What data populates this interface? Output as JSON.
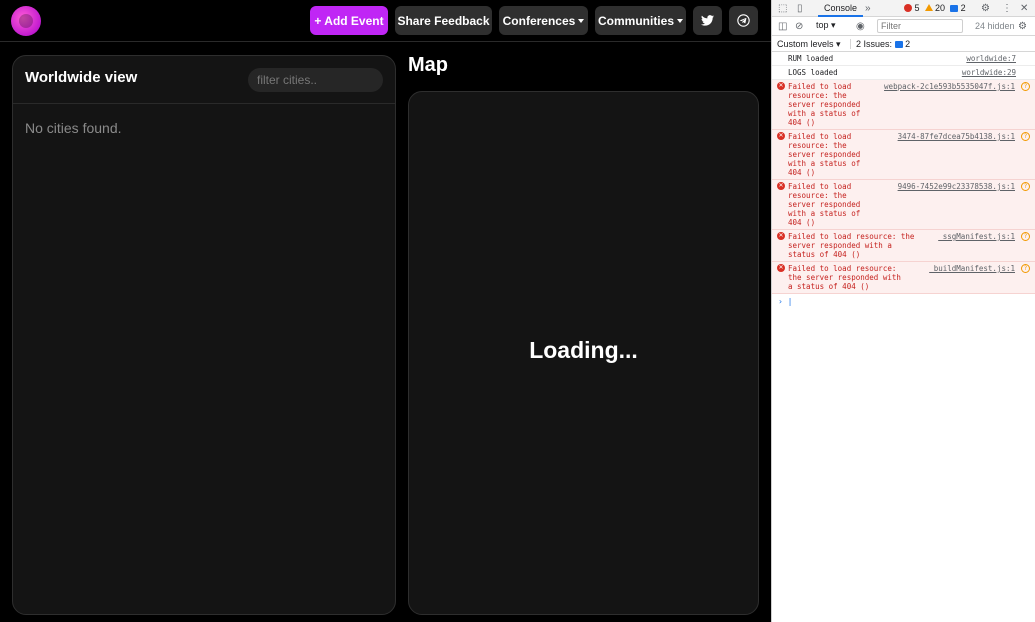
{
  "topbar": {
    "add_event": "+ Add Event",
    "share_feedback": "Share Feedback",
    "conferences": "Conferences",
    "communities": "Communities"
  },
  "left_panel": {
    "title": "Worldwide view",
    "filter_placeholder": "filter cities..",
    "empty_text": "No cities found."
  },
  "map_panel": {
    "title": "Map",
    "loading": "Loading..."
  },
  "devtools": {
    "tab_console": "Console",
    "more": "»",
    "error_count": "5",
    "warning_count": "20",
    "info_count": "2",
    "context": "top",
    "filter_placeholder": "Filter",
    "hidden": "24 hidden",
    "levels": "Custom levels",
    "issues_label": "2 Issues:",
    "issues_count": "2",
    "logs": [
      {
        "type": "info",
        "message": "RUM loaded",
        "source": "worldwide:7"
      },
      {
        "type": "info",
        "message": "LOGS loaded",
        "source": "worldwide:29"
      },
      {
        "type": "error",
        "message": "Failed to load resource: the server responded with a status of 404 ()",
        "source": "webpack-2c1e593b5535047f.js:1"
      },
      {
        "type": "error",
        "message": "Failed to load resource: the server responded with a status of 404 ()",
        "source": "3474-87fe7dcea75b4138.js:1"
      },
      {
        "type": "error",
        "message": "Failed to load resource: the server responded with a status of 404 ()",
        "source": "9496-7452e99c23378538.js:1"
      },
      {
        "type": "error",
        "message": "Failed to load resource: the server responded with a status of 404 ()",
        "source": "_ssgManifest.js:1"
      },
      {
        "type": "error",
        "message": "Failed to load resource: the server responded with a status of 404 ()",
        "source": "_buildManifest.js:1"
      }
    ]
  }
}
